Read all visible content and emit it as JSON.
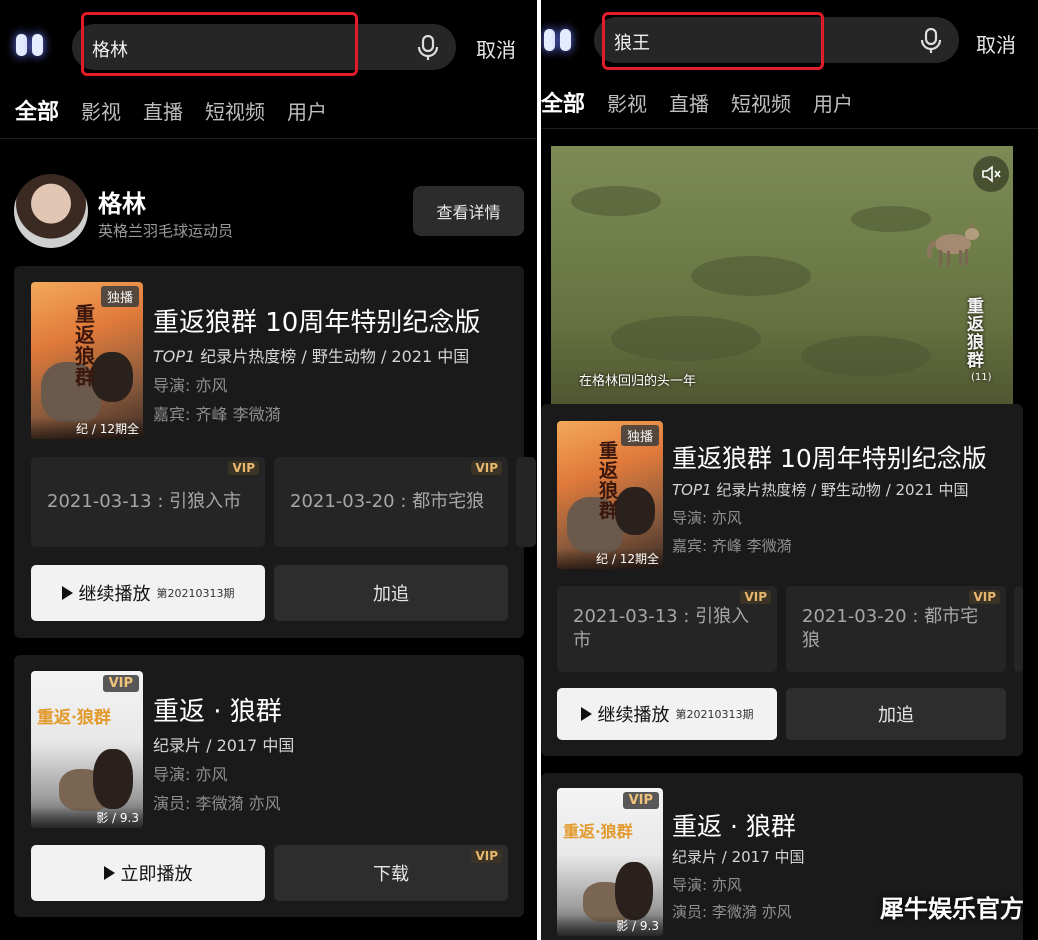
{
  "left": {
    "search": {
      "value": "格林"
    },
    "cancel_label": "取消",
    "tabs": [
      "全部",
      "影视",
      "直播",
      "短视频",
      "用户"
    ],
    "person": {
      "name": "格林",
      "description": "英格兰羽毛球运动员",
      "detail_label": "查看详情"
    },
    "card1": {
      "badge": "独播",
      "poster_calligraphy": "重返狼群",
      "poster_footer": "纪 / 12期全",
      "title": "重返狼群 10周年特别纪念版",
      "meta_rank": "TOP1",
      "meta_rest": " 纪录片热度榜 / 野生动物 / 2021 中国",
      "director_label": "导演:",
      "director": "亦风",
      "guest_label": "嘉宾:",
      "guests": "齐峰 李微漪",
      "episodes": [
        {
          "text": "2021-03-13 : 引狼入市",
          "vip": "VIP"
        },
        {
          "text": "2021-03-20 : 都市宅狼",
          "vip": "VIP"
        }
      ],
      "play_label": "继续播放",
      "play_episode": "第20210313期",
      "follow_label": "加追"
    },
    "card2": {
      "badge": "VIP",
      "poster_calligraphy": "重返·狼群",
      "poster_footer": "影 / 9.3",
      "title": "重返 · 狼群",
      "meta": "纪录片 / 2017 中国",
      "director_label": "导演:",
      "director": "亦风",
      "cast_label": "演员:",
      "cast": "李微漪 亦风",
      "play_label": "立即播放",
      "download_label": "下载",
      "download_vip": "VIP"
    }
  },
  "right": {
    "search": {
      "value": "狼王"
    },
    "cancel_label": "取消",
    "tabs": [
      "全部",
      "影视",
      "直播",
      "短视频",
      "用户"
    ],
    "video": {
      "subtitle": "在格林回归的头一年",
      "logo": "重返狼群",
      "logo_sub": "(11)"
    },
    "card1": {
      "badge": "独播",
      "poster_calligraphy": "重返狼群",
      "poster_footer": "纪 / 12期全",
      "title": "重返狼群 10周年特别纪念版",
      "meta_rank": "TOP1",
      "meta_rest": " 纪录片热度榜 / 野生动物 / 2021 中国",
      "director_label": "导演:",
      "director": "亦风",
      "guest_label": "嘉宾:",
      "guests": "齐峰 李微漪",
      "episodes": [
        {
          "text": "2021-03-13 : 引狼入市",
          "vip": "VIP"
        },
        {
          "text": "2021-03-20 : 都市宅狼",
          "vip": "VIP"
        }
      ],
      "play_label": "继续播放",
      "play_episode": "第20210313期",
      "follow_label": "加追"
    },
    "card2": {
      "badge": "VIP",
      "poster_calligraphy": "重返·狼群",
      "poster_footer": "影 / 9.3",
      "title": "重返 · 狼群",
      "meta": "纪录片 / 2017 中国",
      "director_label": "导演:",
      "director": "亦风",
      "cast_label": "演员:",
      "cast": "李微漪 亦风"
    }
  },
  "watermark": "犀牛娱乐官方",
  "colors": {
    "highlight_box": "#e11d2a",
    "vip_gold": "#e7b76c",
    "background": "#000000",
    "card": "#1a1a1a"
  }
}
